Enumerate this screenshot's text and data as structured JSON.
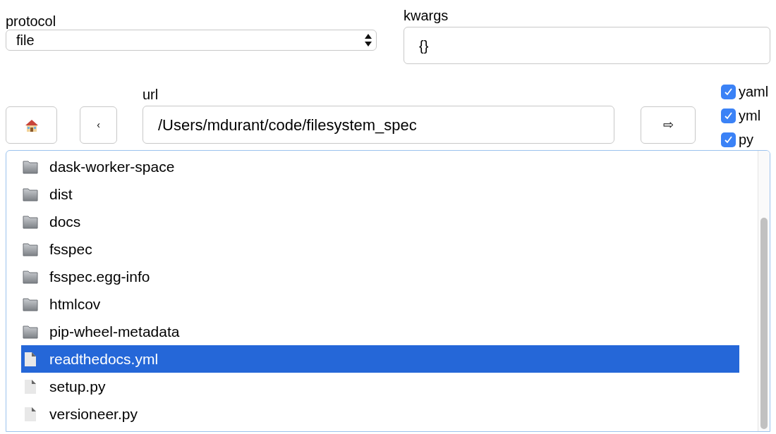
{
  "protocol": {
    "label": "protocol",
    "value": "file"
  },
  "kwargs": {
    "label": "kwargs",
    "value": "{}"
  },
  "nav": {
    "back": "‹",
    "go": "⇨"
  },
  "url": {
    "label": "url",
    "value": "/Users/mdurant/code/filesystem_spec"
  },
  "filters": [
    {
      "label": "yaml",
      "checked": true
    },
    {
      "label": "yml",
      "checked": true
    },
    {
      "label": "py",
      "checked": true
    }
  ],
  "files": [
    {
      "name": "dask-worker-space",
      "kind": "folder",
      "selected": false
    },
    {
      "name": "dist",
      "kind": "folder",
      "selected": false
    },
    {
      "name": "docs",
      "kind": "folder",
      "selected": false
    },
    {
      "name": "fsspec",
      "kind": "folder",
      "selected": false
    },
    {
      "name": "fsspec.egg-info",
      "kind": "folder",
      "selected": false
    },
    {
      "name": "htmlcov",
      "kind": "folder",
      "selected": false
    },
    {
      "name": "pip-wheel-metadata",
      "kind": "folder",
      "selected": false
    },
    {
      "name": "readthedocs.yml",
      "kind": "file",
      "selected": true
    },
    {
      "name": "setup.py",
      "kind": "file",
      "selected": false
    },
    {
      "name": "versioneer.py",
      "kind": "file",
      "selected": false
    }
  ]
}
